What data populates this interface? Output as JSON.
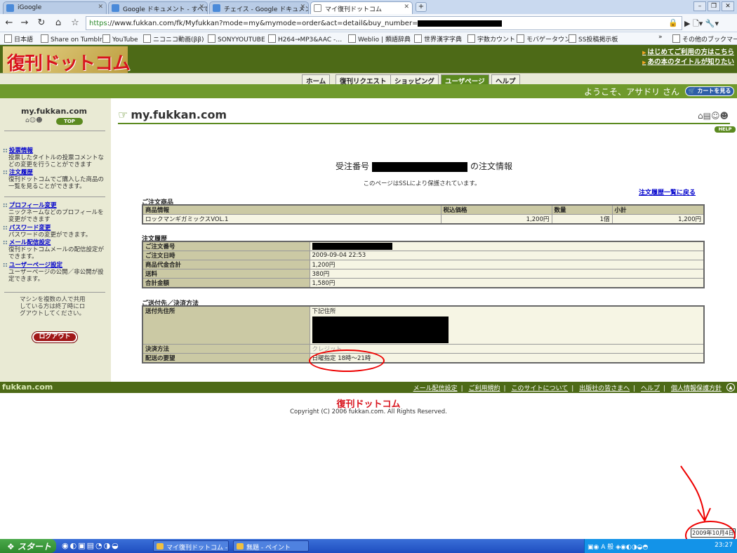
{
  "browser": {
    "tabs": [
      {
        "label": "iGoogle"
      },
      {
        "label": "Google ドキュメント - すべて…"
      },
      {
        "label": "チェイス - Google ドキュメント"
      },
      {
        "label": "マイ復刊ドットコム"
      }
    ],
    "url_prefix": "https",
    "url_rest": "://www.fukkan.com/fk/Myfukkan?mode=my&mymode=order&act=detail&buy_number=",
    "bookmarks": [
      "日本語",
      "Share on Tumblr",
      "YouTube",
      "ニコニコ動画(ββ)",
      "SONYYOUTUBE",
      "H264→MP3&AAC -…",
      "Weblio | 類語辞典",
      "世界漢字字典",
      "宇数カウント",
      "モバゲータウン",
      "SS投稿掲示板"
    ],
    "other_bookmarks": "その他のブックマーク"
  },
  "site": {
    "logo": "復刊ドットコム",
    "top_links": [
      "はじめてご利用の方はこちら",
      "あの本のタイトルが知りたい"
    ],
    "menu": [
      "ホーム",
      "復刊リクエスト",
      "ショッピング",
      "ユーザページ",
      "ヘルプ"
    ],
    "welcome": "ようこそ、アサドリ さん",
    "cart_button": "カートを見る"
  },
  "sidebar": {
    "title": "my.fukkan.com",
    "top_badge": "TOP",
    "sections": [
      {
        "link": "投票情報",
        "desc": "投票したタイトルの投票コメントなどの変更を行うことができます"
      },
      {
        "link": "注文履歴",
        "desc": "復刊ドットコムでご購入した商品の一覧を見ることができます。"
      },
      {
        "link": "プロフィール変更",
        "desc": "ニックネームなどのプロフィールを変更ができます"
      },
      {
        "link": "パスワード変更",
        "desc": "パスワードの変更ができます。"
      },
      {
        "link": "メール配信設定",
        "desc": "復刊ドットコムメールの配信設定ができます。"
      },
      {
        "link": "ユーザーページ設定",
        "desc": "ユーザーページの公開／非公開が設定できます。"
      }
    ],
    "note": "マシンを複数の人で共用している方は終了時にログアウトしてください。",
    "logout": "ログアウト"
  },
  "main": {
    "title": "my.fukkan.com",
    "help": "HELP",
    "order_head_prefix": "受注番号",
    "order_head_suffix": "の注文情報",
    "ssl_note": "このページはSSLにより保護されています。",
    "back_link": "注文履歴一覧に戻る",
    "products": {
      "section": "ご注文商品",
      "headers": [
        "商品情報",
        "税込価格",
        "数量",
        "小計"
      ],
      "rows": [
        [
          "ロックマンギガミックスVOL.1",
          "1,200円",
          "1個",
          "1,200円"
        ]
      ]
    },
    "history": {
      "section": "注文履歴",
      "rows": [
        {
          "label": "ご注文番号",
          "value": ""
        },
        {
          "label": "ご注文日時",
          "value": "2009-09-04 22:53"
        },
        {
          "label": "商品代金合計",
          "value": "1,200円"
        },
        {
          "label": "送料",
          "value": "380円"
        },
        {
          "label": "合計金額",
          "value": "1,580円"
        }
      ]
    },
    "shipping": {
      "section": "ご送付先／決済方法",
      "rows": [
        {
          "label": "送付先住所",
          "value": "下記住所"
        },
        {
          "label": "決済方法",
          "value": "クレジット"
        },
        {
          "label": "配送の要望",
          "value": "日曜指定 18時～21時"
        }
      ]
    }
  },
  "footer": {
    "logo": "fukkan.com",
    "links": [
      "メール配信設定",
      "ご利用規約",
      "このサイトについて",
      "出版社の皆さまへ",
      "ヘルプ",
      "個人情報保護方針"
    ],
    "logo_center": "復刊ドットコム",
    "copyright": "Copyright (C) 2006 fukkan.com. All Rights Reserved."
  },
  "annotation": {
    "date": "2009年10月4日"
  },
  "taskbar": {
    "start": "スタート",
    "items": [
      "マイ復刊ドットコム - G…",
      "無題 - ペイント"
    ],
    "clock": "23:27",
    "ime": "A 般"
  },
  "colors": {
    "header_green": "#4d6a17",
    "bar_green": "#6f9a2c",
    "logo_red": "#d8141d",
    "table_head": "#cbc9a4",
    "link_blue": "#0000cc"
  }
}
